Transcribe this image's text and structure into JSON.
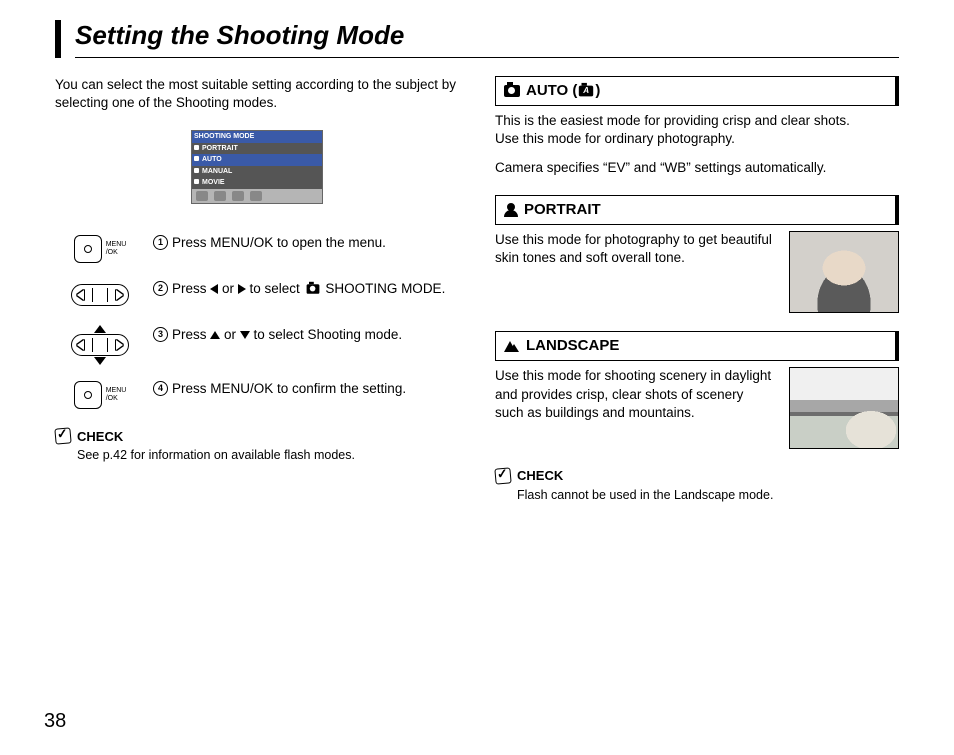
{
  "page_number": "38",
  "title": "Setting the Shooting Mode",
  "intro": "You can select the most suitable setting according to the subject by selecting one of the Shooting modes.",
  "lcd": {
    "header": "SHOOTING MODE",
    "items": [
      "PORTRAIT",
      "AUTO",
      "MANUAL",
      "MOVIE"
    ],
    "selected_index": 1
  },
  "menu_ok_label": "MENU\n/OK",
  "steps": [
    {
      "n": "1",
      "text_a": "Press MENU/OK to open the menu.",
      "icon": "menu-ok"
    },
    {
      "n": "2",
      "text_a": "Press ",
      "text_b": " or ",
      "text_c": " to select ",
      "text_d": " SHOOTING MODE.",
      "icon": "lr",
      "inline1": "tri-l",
      "inline2": "tri-r",
      "inline3": "camera"
    },
    {
      "n": "3",
      "text_a": "Press ",
      "text_b": " or ",
      "text_c": " to select Shooting mode.",
      "icon": "ud",
      "inline1": "tri-u",
      "inline2": "tri-d"
    },
    {
      "n": "4",
      "text_a": "Press MENU/OK to confirm the setting.",
      "icon": "menu-ok"
    }
  ],
  "check_left": {
    "label": "CHECK",
    "text": "See p.42 for information on available flash modes."
  },
  "sections": {
    "auto": {
      "title": "AUTO (",
      "title_suffix": ")",
      "body_a": "This is the easiest mode for providing crisp and clear shots.",
      "body_b": "Use this mode for ordinary photography.",
      "body_c": "Camera specifies “EV” and “WB” settings automatically."
    },
    "portrait": {
      "title": "PORTRAIT",
      "body": "Use this mode for photography to get beautiful skin tones and soft overall tone."
    },
    "landscape": {
      "title": "LANDSCAPE",
      "body": "Use this mode for shooting scenery in daylight and provides crisp, clear shots of scenery such as buildings and mountains."
    }
  },
  "check_right": {
    "label": "CHECK",
    "text": "Flash cannot be used in the Landscape mode."
  }
}
